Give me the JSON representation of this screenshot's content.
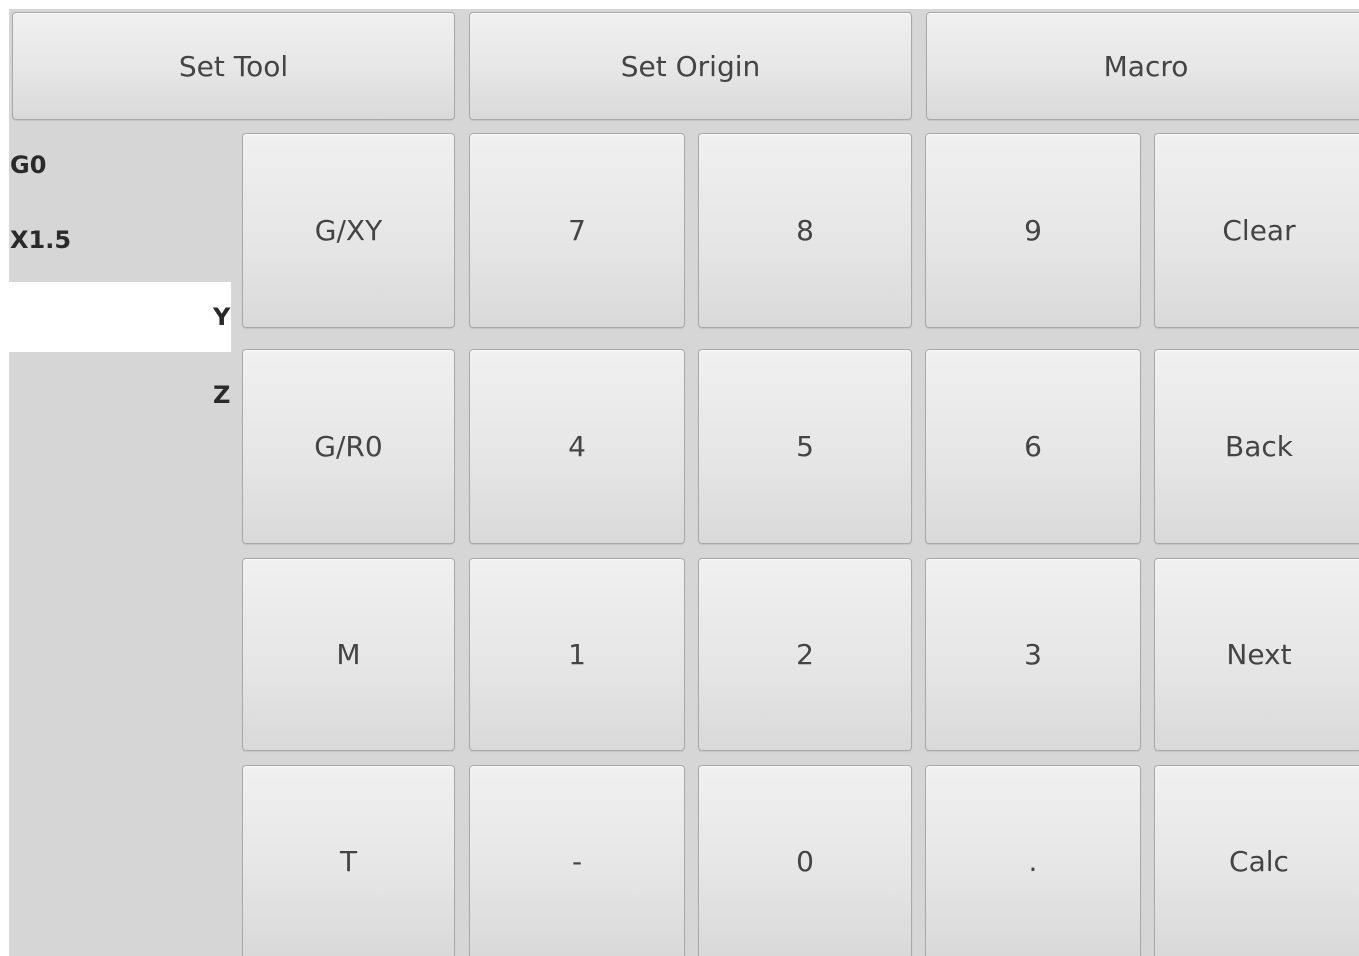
{
  "toolbar": {
    "set_tool": "Set Tool",
    "set_origin": "Set Origin",
    "macro": "Macro"
  },
  "gcode": {
    "line1": "G0",
    "line2": "X1.5",
    "axis_y": "Y",
    "axis_z": "Z",
    "input_value": ""
  },
  "keypad": {
    "r1": [
      "G/XY",
      "7",
      "8",
      "9",
      "Clear"
    ],
    "r2": [
      "G/R0",
      "4",
      "5",
      "6",
      "Back"
    ],
    "r3": [
      "M",
      "1",
      "2",
      "3",
      "Next"
    ],
    "r4": [
      "T",
      "-",
      "0",
      ".",
      "Calc"
    ]
  },
  "colors": {
    "panel_background": "#d6d6d6",
    "button_face": "#e6e6e6",
    "button_text": "#444444",
    "entry_field": "#ffffff"
  }
}
